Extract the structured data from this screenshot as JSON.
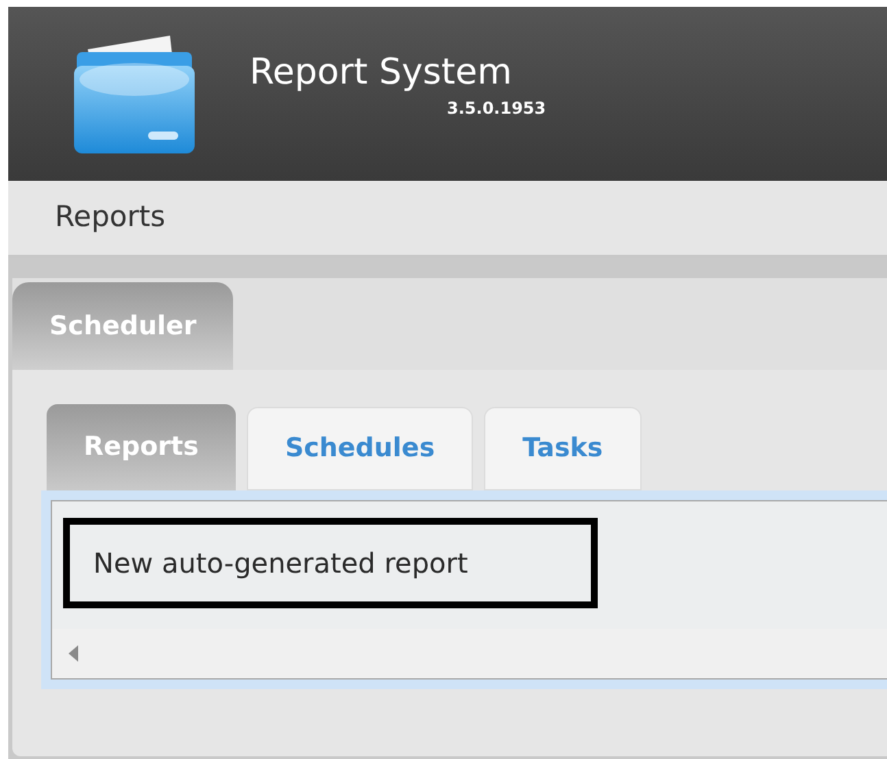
{
  "header": {
    "title": "Report System",
    "version": "3.5.0.1953"
  },
  "menu": {
    "items": [
      {
        "label": "Reports"
      }
    ]
  },
  "outer_tabs": [
    {
      "label": "Scheduler",
      "selected": true
    }
  ],
  "inner_tabs": [
    {
      "label": "Reports",
      "selected": true
    },
    {
      "label": "Schedules",
      "selected": false
    },
    {
      "label": "Tasks",
      "selected": false
    }
  ],
  "list": {
    "items": [
      {
        "label": "New auto-generated report",
        "highlighted": true
      }
    ]
  }
}
